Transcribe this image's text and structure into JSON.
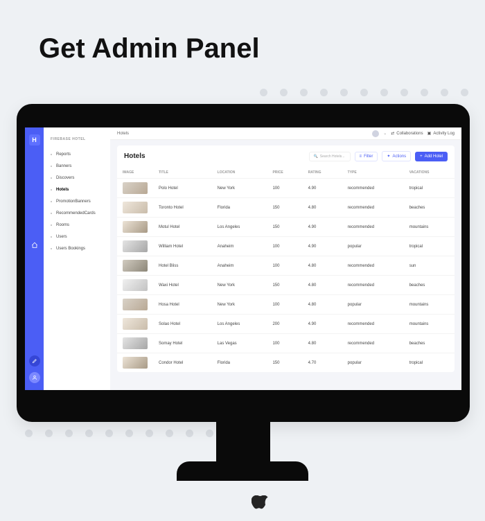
{
  "hero": "Get Admin Panel",
  "brand": "FIREBASE HOTEL",
  "logo": "H",
  "nav": [
    {
      "label": "Reports"
    },
    {
      "label": "Banners"
    },
    {
      "label": "Discovers"
    },
    {
      "label": "Hotels"
    },
    {
      "label": "PromotionBanners"
    },
    {
      "label": "RecommendedCards"
    },
    {
      "label": "Rooms"
    },
    {
      "label": "Users"
    },
    {
      "label": "Users Bookings"
    }
  ],
  "crumb": "Hotels",
  "top_collab": "Collaborations",
  "top_activity": "Activity Log",
  "panel_title": "Hotels",
  "search_placeholder": "Search Hotels...",
  "btn_filter": "Filter",
  "btn_actions": "Actions",
  "btn_add": "Add Hotel",
  "columns": [
    "IMAGE",
    "TITLE",
    "LOCATION",
    "PRICE",
    "RATING",
    "TYPE",
    "VACATIONS"
  ],
  "rows": [
    {
      "title": "Polo Hotel",
      "location": "New York",
      "price": "100",
      "rating": "4.90",
      "type": "recommended",
      "vacations": "tropical",
      "thumb": ""
    },
    {
      "title": "Toronto Hotel",
      "location": "Florida",
      "price": "150",
      "rating": "4.80",
      "type": "recommended",
      "vacations": "beaches",
      "thumb": "b"
    },
    {
      "title": "Motul Hotel",
      "location": "Los Angeles",
      "price": "150",
      "rating": "4.90",
      "type": "recommended",
      "vacations": "mountains",
      "thumb": "c"
    },
    {
      "title": "William Hotel",
      "location": "Anaheim",
      "price": "100",
      "rating": "4.90",
      "type": "popular",
      "vacations": "tropical",
      "thumb": "d"
    },
    {
      "title": "Hotel Bliss",
      "location": "Anaheim",
      "price": "100",
      "rating": "4.80",
      "type": "recommended",
      "vacations": "sun",
      "thumb": "e"
    },
    {
      "title": "Waxi Hotel",
      "location": "New York",
      "price": "150",
      "rating": "4.80",
      "type": "recommended",
      "vacations": "beaches",
      "thumb": "f"
    },
    {
      "title": "Hosa Hotel",
      "location": "New York",
      "price": "100",
      "rating": "4.80",
      "type": "popular",
      "vacations": "mountains",
      "thumb": ""
    },
    {
      "title": "Solao Hotel",
      "location": "Los Angeles",
      "price": "200",
      "rating": "4.90",
      "type": "recommended",
      "vacations": "mountains",
      "thumb": "b"
    },
    {
      "title": "Somay Hotel",
      "location": "Las Vegas",
      "price": "100",
      "rating": "4.80",
      "type": "recommended",
      "vacations": "beaches",
      "thumb": "d"
    },
    {
      "title": "Condor Hotel",
      "location": "Florida",
      "price": "150",
      "rating": "4.70",
      "type": "popular",
      "vacations": "tropical",
      "thumb": "c"
    }
  ]
}
